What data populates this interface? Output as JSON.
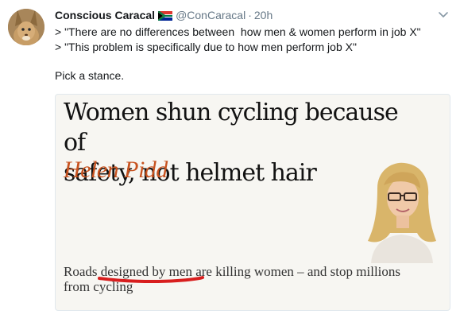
{
  "tweet": {
    "display_name": "Conscious Caracal",
    "flag_icon": "south-africa-flag-icon",
    "handle": "@ConCaracal",
    "separator": "·",
    "time": "20h",
    "lines": [
      "> \"There are no differences between  how men & women perform in job X\"",
      "> \"This problem is specifically due to how men perform job X\""
    ],
    "closing": "Pick a stance."
  },
  "article": {
    "headline_line1": "Women shun cycling because of",
    "headline_line2": "safety, not helmet hair",
    "author": "Helen Pidd",
    "standfirst_line1": "Roads designed by men are killing women – and stop millions",
    "standfirst_line2": "from cycling",
    "annotation_color": "#d81e1e"
  },
  "colors": {
    "text": "#14171a",
    "muted": "#657786",
    "byline": "#c7521f"
  }
}
